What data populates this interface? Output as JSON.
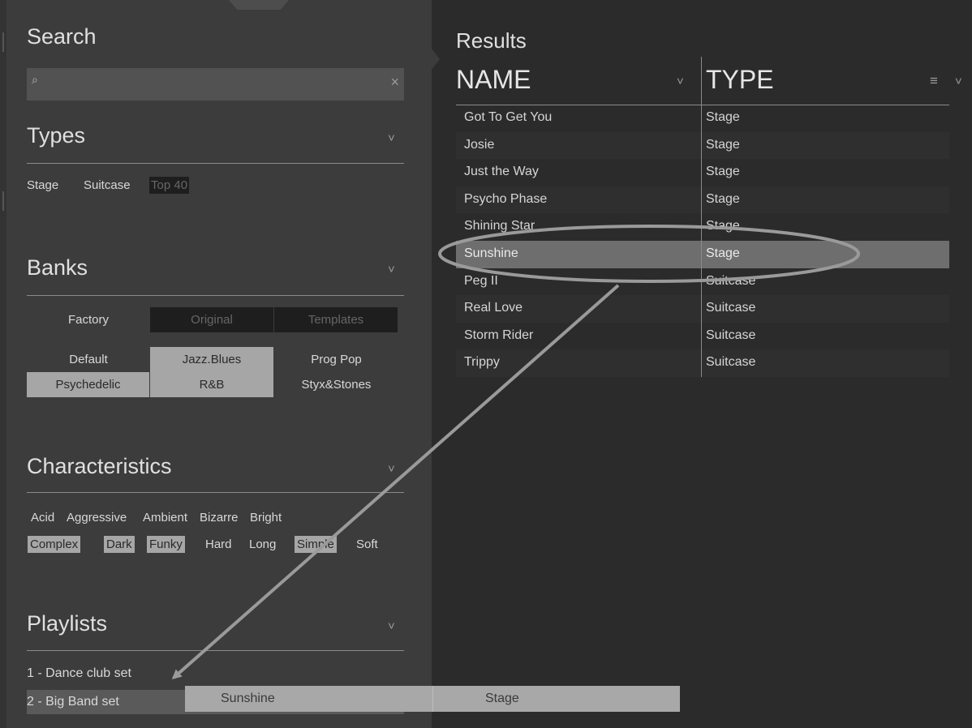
{
  "left": {
    "search": {
      "title": "Search",
      "placeholder": "",
      "search_icon": "search-icon",
      "clear_icon": "close-icon",
      "clear_glyph": "×"
    },
    "types": {
      "title": "Types",
      "items": [
        "Stage",
        "Suitcase",
        "Top 40"
      ]
    },
    "banks": {
      "title": "Banks",
      "items": [
        "Factory",
        "Original",
        "Templates",
        "Default",
        "Jazz.Blues",
        "Prog Pop",
        "Psychedelic",
        "R&B",
        "Styx&Stones"
      ]
    },
    "characteristics": {
      "title": "Characteristics",
      "items": [
        "Acid",
        "Aggressive",
        "Ambient",
        "Bizarre",
        "Bright",
        "Complex",
        "Dark",
        "Funky",
        "Hard",
        "Long",
        "Simple",
        "Soft"
      ]
    },
    "playlists": {
      "title": "Playlists",
      "items": [
        "1 - Dance club set",
        "2 - Big Band set"
      ]
    }
  },
  "results": {
    "title": "Results",
    "columns": {
      "name": "NAME",
      "type": "TYPE"
    },
    "rows": [
      {
        "name": "Got To Get You",
        "type": "Stage"
      },
      {
        "name": "Josie",
        "type": "Stage"
      },
      {
        "name": "Just the Way",
        "type": "Stage"
      },
      {
        "name": "Psycho Phase",
        "type": "Stage"
      },
      {
        "name": "Shining Star",
        "type": "Stage"
      },
      {
        "name": "Sunshine",
        "type": "Stage"
      },
      {
        "name": "Peg II",
        "type": "Suitcase"
      },
      {
        "name": "Real Love",
        "type": "Suitcase"
      },
      {
        "name": "Storm Rider",
        "type": "Suitcase"
      },
      {
        "name": "Trippy",
        "type": "Suitcase"
      }
    ],
    "selected_row": "Sunshine"
  },
  "drag": {
    "name": "Sunshine",
    "type": "Stage"
  },
  "icons": {
    "chevron": "˅",
    "menu": "≡",
    "magnifier": "⌕"
  },
  "colors": {
    "panel_left": "#3c3c3c",
    "panel_right": "#2b2b2b",
    "selected": "#a6a6a6",
    "annotation": "#9a9a9a"
  }
}
